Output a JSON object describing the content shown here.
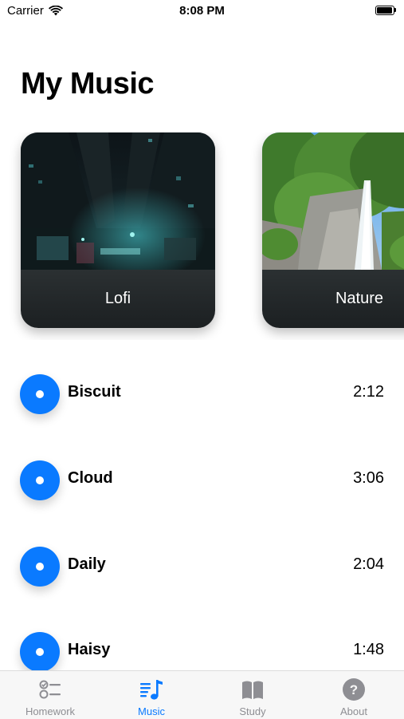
{
  "status_bar": {
    "carrier": "Carrier",
    "time": "8:08 PM"
  },
  "page": {
    "title": "My Music"
  },
  "playlists": [
    {
      "label": "Lofi"
    },
    {
      "label": "Nature"
    }
  ],
  "tracks": [
    {
      "name": "Biscuit",
      "duration": "2:12"
    },
    {
      "name": "Cloud",
      "duration": "3:06"
    },
    {
      "name": "Daily",
      "duration": "2:04"
    },
    {
      "name": "Haisy",
      "duration": "1:48"
    }
  ],
  "tab_bar": {
    "active": "Music",
    "tabs": [
      {
        "label": "Homework",
        "icon": "checklist-icon"
      },
      {
        "label": "Music",
        "icon": "music-list-icon"
      },
      {
        "label": "Study",
        "icon": "book-icon"
      },
      {
        "label": "About",
        "icon": "question-circle-icon"
      }
    ]
  },
  "colors": {
    "accent": "#0a7aff",
    "inactive": "#8e8e93",
    "card_caption": "#23282a"
  }
}
